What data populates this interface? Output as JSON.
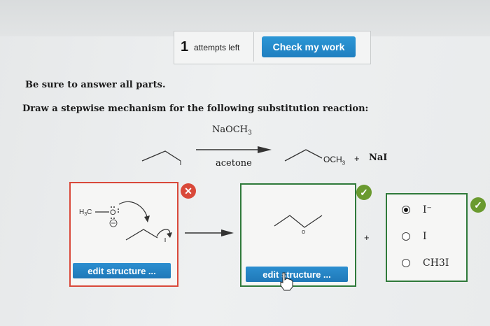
{
  "header": {
    "attempts_count": "1",
    "attempts_label": "attempts left",
    "check_button_label": "Check my work"
  },
  "instruction": "Be sure to answer all parts.",
  "question": "Draw a stepwise mechanism for the following substitution reaction:",
  "reaction": {
    "reagent_above": "NaOCH3",
    "reagent_below": "acetone",
    "product_group": "OCH3",
    "plus": "+",
    "byproduct": "NaI"
  },
  "answer_panels": {
    "left_label_h3c": "H3C",
    "edit_structure_label": "edit structure ...",
    "plus": "+",
    "options": [
      {
        "label": "I⁻",
        "selected": true
      },
      {
        "label": "I",
        "selected": false
      },
      {
        "label": "CH3I",
        "selected": false
      }
    ]
  },
  "colors": {
    "accent_blue": "#1f7fc0",
    "incorrect_red": "#d9493a",
    "correct_green": "#6a9a2f",
    "panel_green": "#2f7a3a"
  },
  "icons": {
    "incorrect": "close-icon",
    "correct": "check-icon",
    "cursor": "hand-cursor-icon"
  }
}
